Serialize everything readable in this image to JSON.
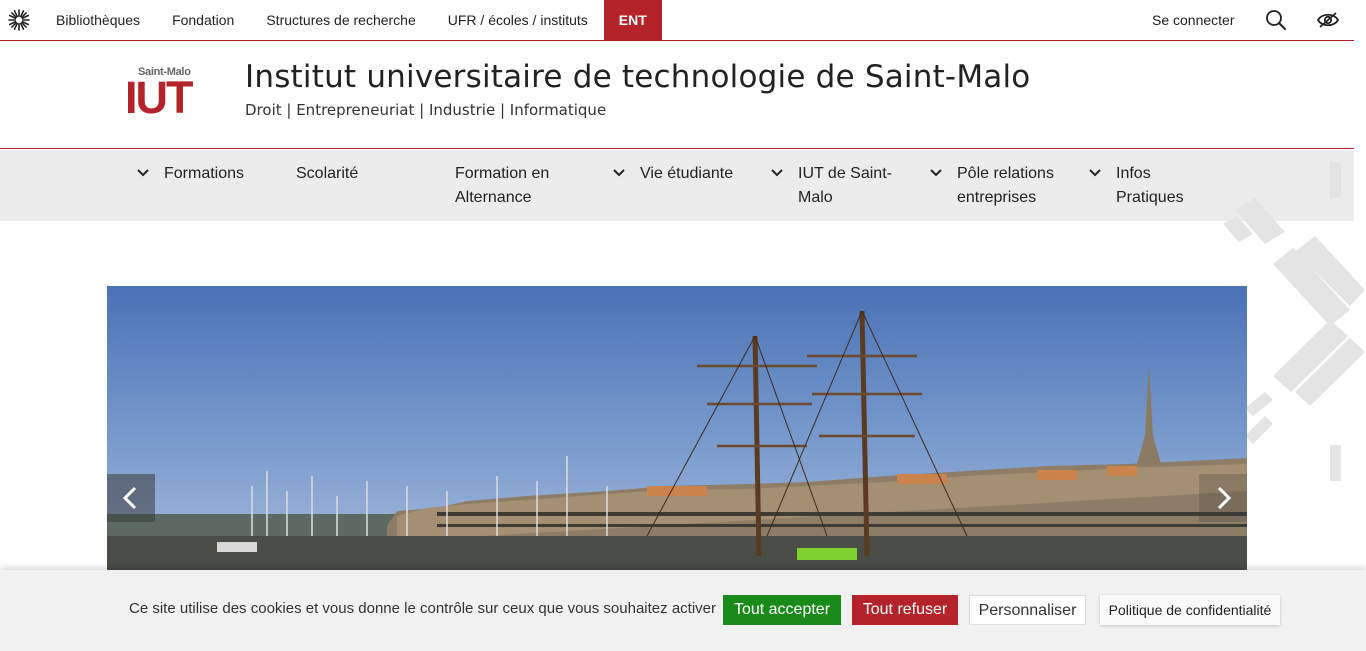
{
  "topbar": {
    "logo_icon": "sun-star-icon",
    "links": [
      "Bibliothèques",
      "Fondation",
      "Structures de recherche",
      "UFR / écoles / instituts"
    ],
    "ent_label": "ENT",
    "login_label": "Se connecter",
    "search_icon": "search-icon",
    "accessibility_icon": "eye-icon"
  },
  "header": {
    "logo_small": "Saint-Malo",
    "logo_big": "IUT",
    "title": "Institut universitaire de technologie de Saint-Malo",
    "subtitle": "Droit | Entrepreneuriat | Industrie | Informatique"
  },
  "nav": {
    "items": [
      {
        "line1": "Formations",
        "line2": ""
      },
      {
        "line1": "Scolarité",
        "line2": ""
      },
      {
        "line1": "Formation en",
        "line2": "Alternance"
      },
      {
        "line1": "Vie étudiante",
        "line2": ""
      },
      {
        "line1": "IUT de Saint-",
        "line2": "Malo"
      },
      {
        "line1": "Pôle relations",
        "line2": "entreprises"
      },
      {
        "line1": "Infos",
        "line2": "Pratiques"
      }
    ]
  },
  "carousel": {
    "prev_icon": "chevron-left-icon",
    "next_icon": "chevron-right-icon"
  },
  "cookie": {
    "message": "Ce site utilise des cookies et vous donne le contrôle sur ceux que vous souhaitez activer",
    "accept": "Tout accepter",
    "refuse": "Tout refuser",
    "customize": "Personnaliser",
    "policy": "Politique de confidentialité"
  },
  "colors": {
    "brand": "#b5232a",
    "accept": "#1a8a1a",
    "nav_bg": "#ececec"
  }
}
